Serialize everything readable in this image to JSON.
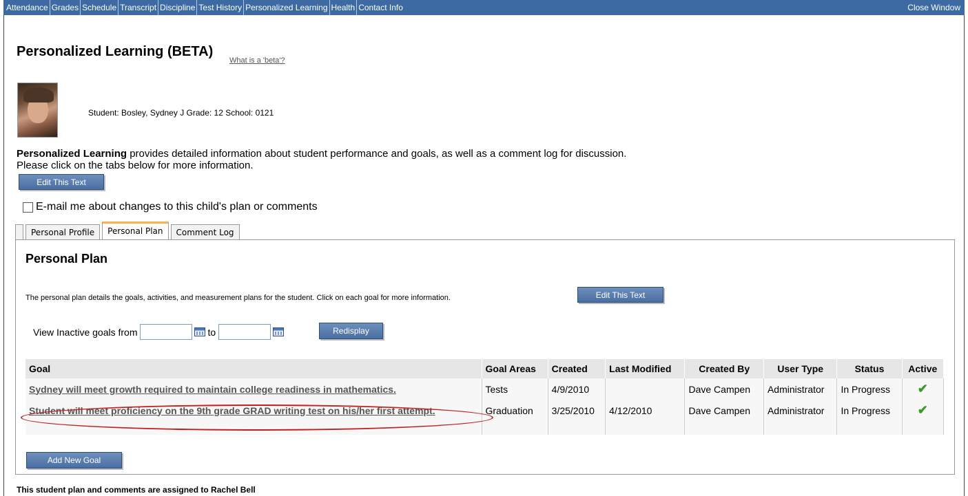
{
  "topnav": {
    "links": [
      "Attendance",
      "Grades",
      "Schedule",
      "Transcript",
      "Discipline",
      "Test History",
      "Personalized Learning",
      "Health",
      "Contact Info"
    ],
    "close": "Close Window"
  },
  "header": {
    "title": "Personalized Learning (BETA)",
    "beta_link": "What is a 'beta'?"
  },
  "student": {
    "info": "Student: Bosley, Sydney J Grade: 12 School: 0121"
  },
  "intro": {
    "bold": "Personalized Learning",
    "rest": " provides detailed information about student performance and goals, as well as a comment log for discussion.",
    "line2": "Please click on the tabs below for more information.",
    "edit_label": "Edit This Text"
  },
  "email_pref": {
    "label": "E-mail me about changes to this child's plan or comments"
  },
  "tabs": [
    "Personal Profile",
    "Personal Plan",
    "Comment Log"
  ],
  "plan": {
    "title": "Personal Plan",
    "desc": "The personal plan details the goals, activities, and measurement plans for the student. Click on each goal for more information.",
    "edit_label": "Edit This Text",
    "filter_label": "View Inactive goals from",
    "filter_to": "to",
    "redisplay": "Redisplay",
    "columns": [
      "Goal",
      "Goal Areas",
      "Created",
      "Last Modified",
      "Created By",
      "User Type",
      "Status",
      "Active"
    ],
    "rows": [
      {
        "goal": "Sydney will meet growth required to maintain college readiness in mathematics.",
        "area": "Tests",
        "created": "4/9/2010",
        "modified": "",
        "by": "Dave Campen",
        "type": "Administrator",
        "status": "In Progress",
        "active": "✔"
      },
      {
        "goal": "Student will meet proficiency on the 9th grade GRAD writing test on his/her first attempt.",
        "area": "Graduation",
        "created": "3/25/2010",
        "modified": "4/12/2010",
        "by": "Dave Campen",
        "type": "Administrator",
        "status": "In Progress",
        "active": "✔"
      }
    ],
    "add_goal": "Add New Goal"
  },
  "footer": {
    "text": "This student plan and comments are assigned to Rachel Bell"
  }
}
